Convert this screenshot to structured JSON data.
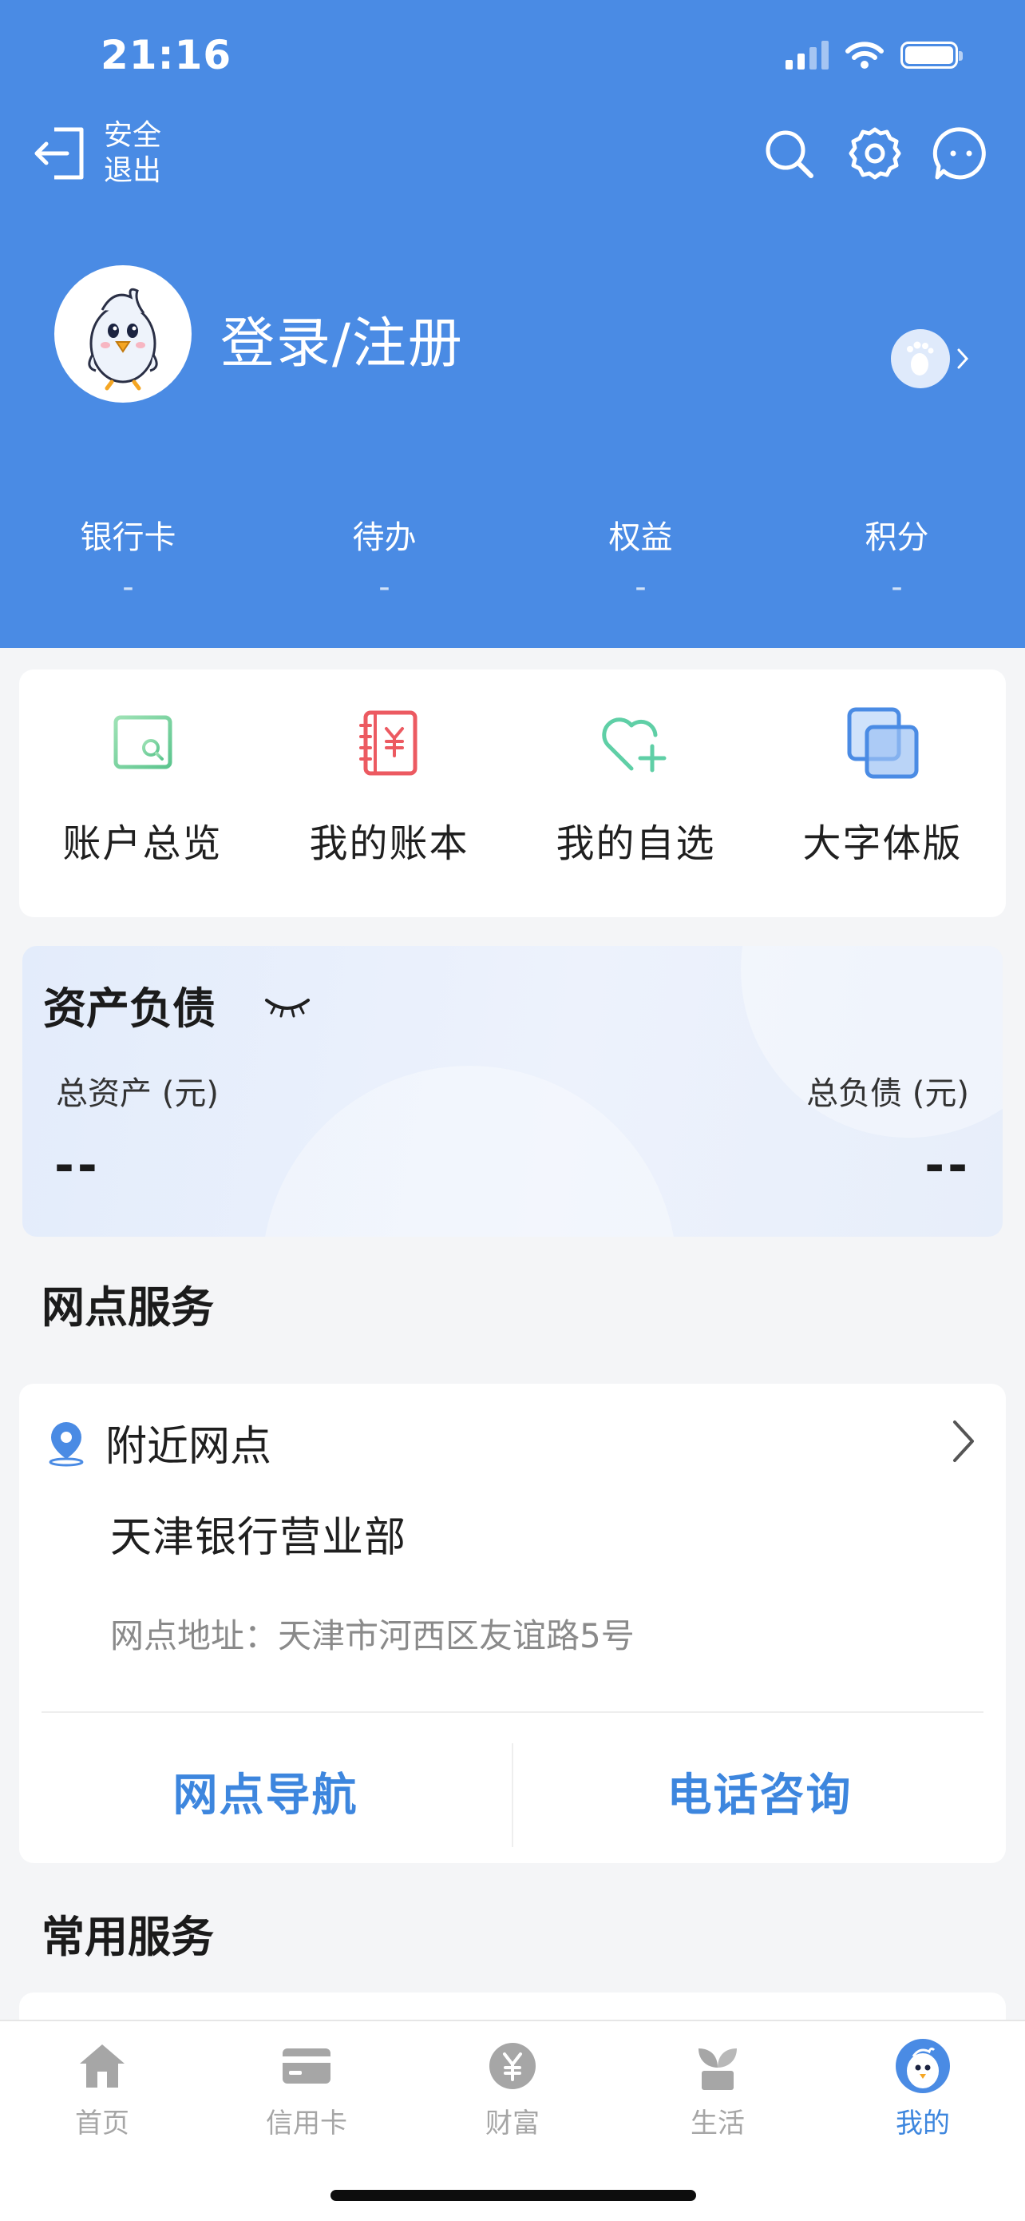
{
  "status_bar": {
    "time": "21:16"
  },
  "header": {
    "logout_label": "安全\n退出",
    "login_title": "登录/注册",
    "stats": [
      {
        "label": "银行卡",
        "value": "-"
      },
      {
        "label": "待办",
        "value": "-"
      },
      {
        "label": "权益",
        "value": "-"
      },
      {
        "label": "积分",
        "value": "-"
      }
    ]
  },
  "quick_actions": [
    {
      "label": "账户总览",
      "icon": "account-overview-icon"
    },
    {
      "label": "我的账本",
      "icon": "ledger-icon"
    },
    {
      "label": "我的自选",
      "icon": "favorite-add-icon"
    },
    {
      "label": "大字体版",
      "icon": "large-font-icon"
    }
  ],
  "assets": {
    "title": "资产负债",
    "total_assets_label": "总资产 (元)",
    "total_assets_value": "--",
    "total_debt_label": "总负债 (元)",
    "total_debt_value": "--"
  },
  "branch_section": {
    "title": "网点服务",
    "nearby_label": "附近网点",
    "branch_name": "天津银行营业部",
    "address": "网点地址：天津市河西区友谊路5号",
    "nav_button": "网点导航",
    "call_button": "电话咨询"
  },
  "common_services": {
    "title": "常用服务"
  },
  "tab_bar": [
    {
      "label": "首页",
      "icon": "home-icon",
      "active": false
    },
    {
      "label": "信用卡",
      "icon": "credit-card-icon",
      "active": false
    },
    {
      "label": "财富",
      "icon": "wealth-icon",
      "active": false
    },
    {
      "label": "生活",
      "icon": "life-sprout-icon",
      "active": false
    },
    {
      "label": "我的",
      "icon": "mascot-avatar-icon",
      "active": true
    }
  ],
  "colors": {
    "header_blue": "#4a8be4",
    "accent_blue": "#3d86de",
    "tab_inactive": "#a6a6a6"
  }
}
